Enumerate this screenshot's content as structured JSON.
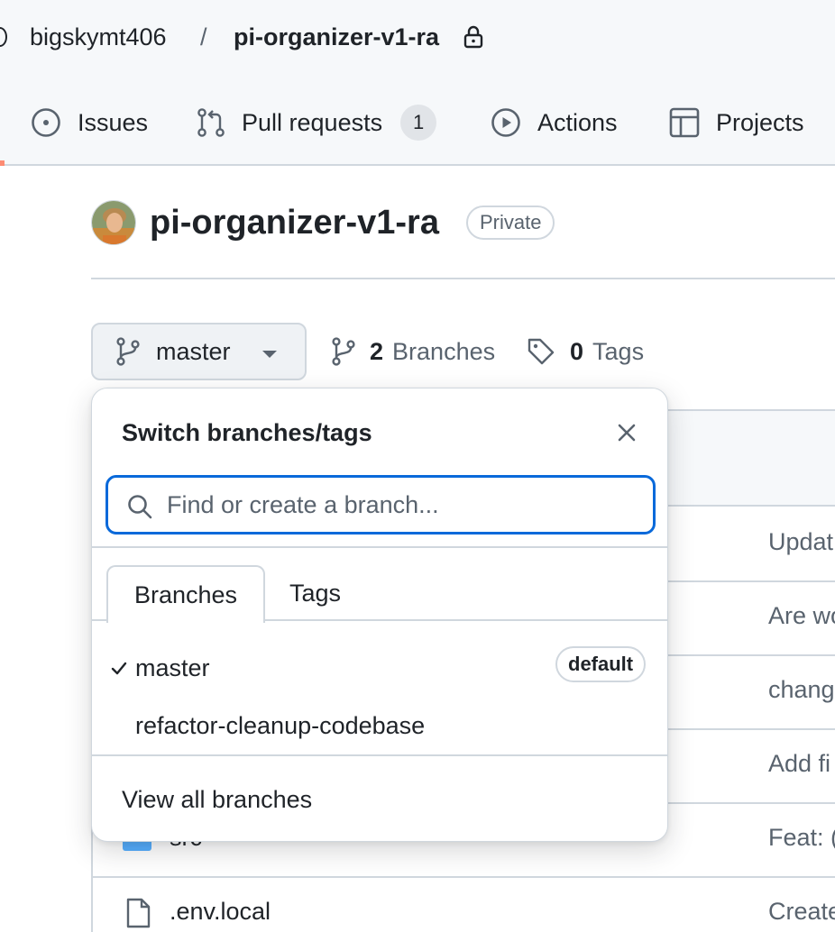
{
  "header": {
    "owner": "bigskymt406",
    "separator": "/",
    "repo": "pi-organizer-v1-ra",
    "lock_icon": "lock-icon"
  },
  "nav_tabs": [
    {
      "label": "Issues",
      "icon": "issue-opened-icon"
    },
    {
      "label": "Pull requests",
      "icon": "git-pull-request-icon",
      "count": "1"
    },
    {
      "label": "Actions",
      "icon": "play-icon"
    },
    {
      "label": "Projects",
      "icon": "table-icon"
    }
  ],
  "repo_header": {
    "title": "pi-organizer-v1-ra",
    "visibility": "Private",
    "avatar": "avatar"
  },
  "branch_bar": {
    "current_branch": "master",
    "branches_count": "2",
    "branches_label": "Branches",
    "tags_count": "0",
    "tags_label": "Tags"
  },
  "popover": {
    "title": "Switch branches/tags",
    "search_placeholder": "Find or create a branch...",
    "tabs": [
      "Branches",
      "Tags"
    ],
    "branches": [
      {
        "name": "master",
        "selected": true,
        "badge": "default"
      },
      {
        "name": "refactor-cleanup-codebase",
        "selected": false
      }
    ],
    "footer_link": "View all branches"
  },
  "file_list": {
    "commit_messages": [
      "Updat",
      "Are wo",
      "chang",
      "Add fi",
      "Feat: (",
      "Create"
    ],
    "visible_files": [
      {
        "name": "src",
        "type": "folder"
      },
      {
        "name": ".env.local",
        "type": "file"
      }
    ]
  },
  "colors": {
    "accent_blue": "#0969da",
    "border": "#d0d7de",
    "muted_text": "#59636e",
    "folder": "#54aeff",
    "underline_accent": "#fd8c73"
  }
}
